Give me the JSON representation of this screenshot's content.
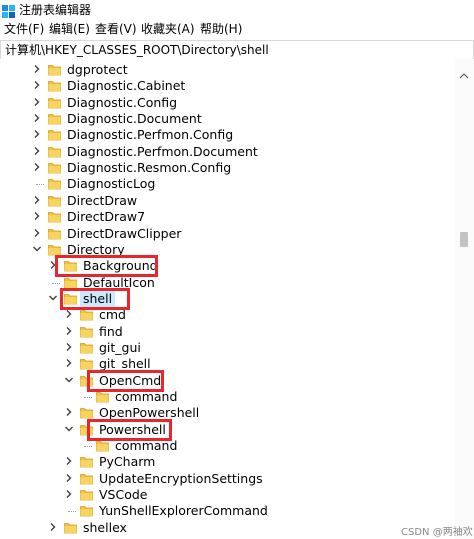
{
  "window": {
    "title": "注册表编辑器"
  },
  "menu": [
    {
      "label": "文件(F)"
    },
    {
      "label": "编辑(E)"
    },
    {
      "label": "查看(V)"
    },
    {
      "label": "收藏夹(A)"
    },
    {
      "label": "帮助(H)"
    }
  ],
  "address": {
    "path": "计算机\\HKEY_CLASSES_ROOT\\Directory\\shell"
  },
  "tree": {
    "nodes": [
      {
        "label": "dgprotect",
        "expander": "collapsed"
      },
      {
        "label": "Diagnostic.Cabinet",
        "expander": "collapsed"
      },
      {
        "label": "Diagnostic.Config",
        "expander": "collapsed"
      },
      {
        "label": "Diagnostic.Document",
        "expander": "collapsed"
      },
      {
        "label": "Diagnostic.Perfmon.Config",
        "expander": "collapsed"
      },
      {
        "label": "Diagnostic.Perfmon.Document",
        "expander": "collapsed"
      },
      {
        "label": "Diagnostic.Resmon.Config",
        "expander": "collapsed"
      },
      {
        "label": "DiagnosticLog",
        "expander": "none"
      },
      {
        "label": "DirectDraw",
        "expander": "collapsed"
      },
      {
        "label": "DirectDraw7",
        "expander": "collapsed"
      },
      {
        "label": "DirectDrawClipper",
        "expander": "collapsed"
      },
      {
        "label": "Directory",
        "expander": "expanded"
      },
      {
        "label": "Background",
        "expander": "collapsed",
        "highlighted": true
      },
      {
        "label": "DefaultIcon",
        "expander": "none"
      },
      {
        "label": "shell",
        "expander": "expanded",
        "highlighted": true,
        "selected": true
      },
      {
        "label": "cmd",
        "expander": "collapsed"
      },
      {
        "label": "find",
        "expander": "collapsed"
      },
      {
        "label": "git_gui",
        "expander": "collapsed"
      },
      {
        "label": "git_shell",
        "expander": "collapsed"
      },
      {
        "label": "OpenCmd",
        "expander": "expanded",
        "highlighted": true
      },
      {
        "label": "command",
        "expander": "none"
      },
      {
        "label": "OpenPowershell",
        "expander": "collapsed"
      },
      {
        "label": "Powershell",
        "expander": "expanded",
        "highlighted": true
      },
      {
        "label": "command",
        "expander": "none"
      },
      {
        "label": "PyCharm",
        "expander": "collapsed"
      },
      {
        "label": "UpdateEncryptionSettings",
        "expander": "collapsed"
      },
      {
        "label": "VSCode",
        "expander": "collapsed"
      },
      {
        "label": "YunShellExplorerCommand",
        "expander": "none"
      },
      {
        "label": "shellex",
        "expander": "collapsed"
      }
    ]
  },
  "watermark": "CSDN @两袖欢",
  "colors": {
    "folder": "#f0c040",
    "highlight": "#e8262c",
    "selection": "#cce8ff"
  }
}
